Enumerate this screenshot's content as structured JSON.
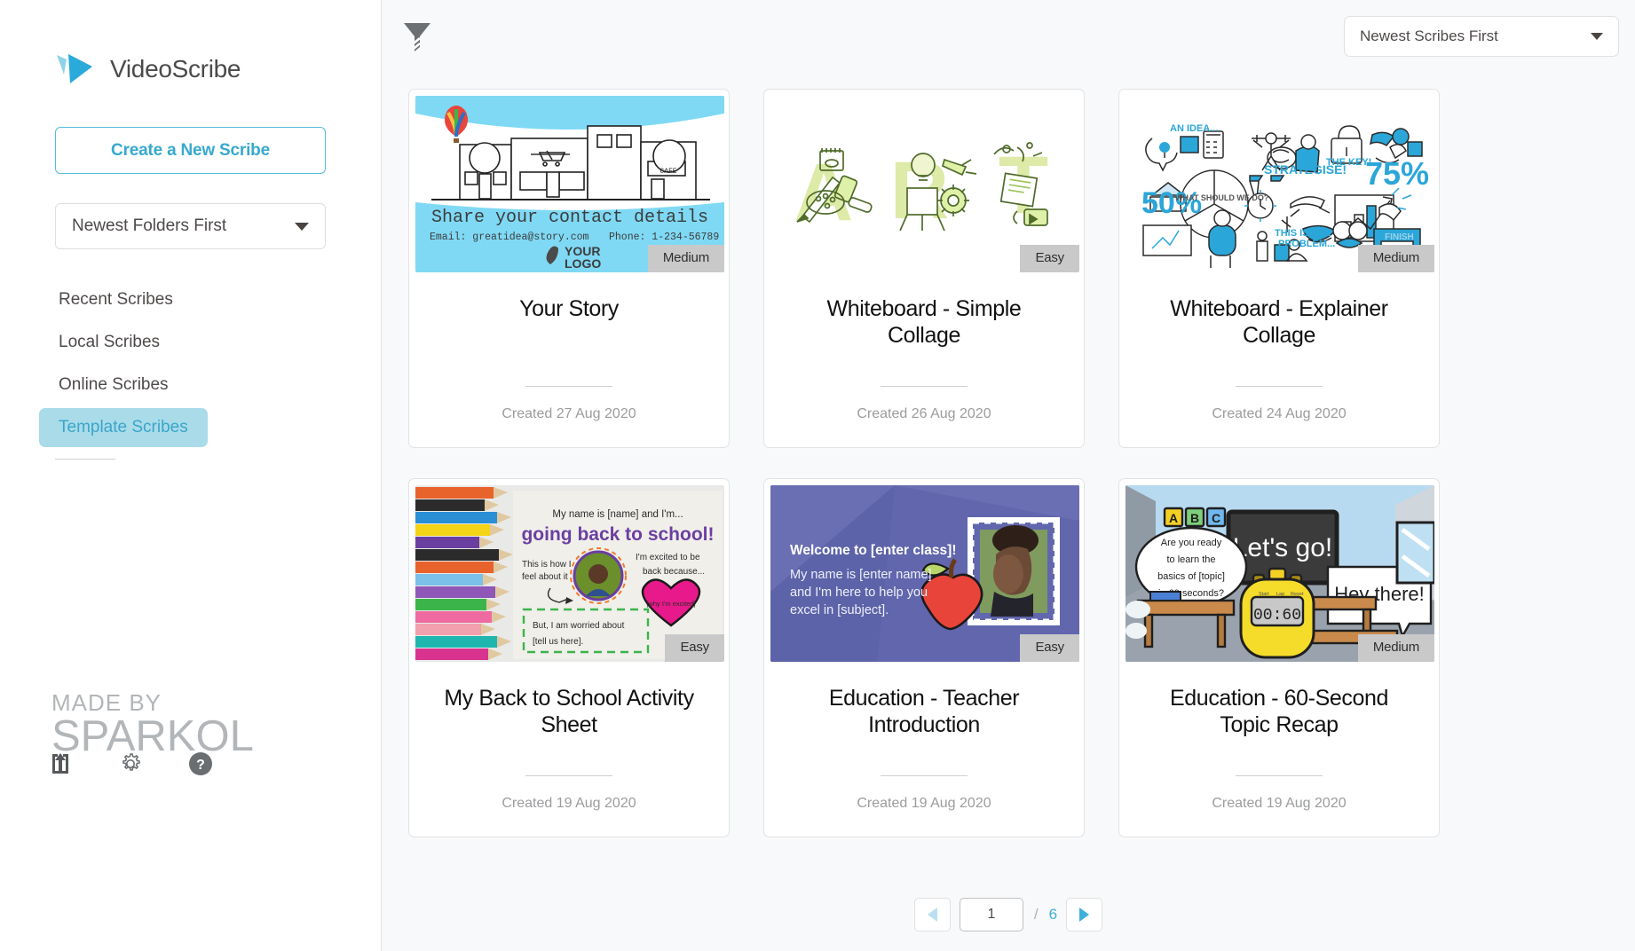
{
  "app": {
    "brand": "VideoScribe"
  },
  "sidebar": {
    "create_button": "Create a New Scribe",
    "folder_sort": {
      "value": "Newest Folders First"
    },
    "nav": [
      {
        "label": "Recent Scribes",
        "active": false
      },
      {
        "label": "Local Scribes",
        "active": false
      },
      {
        "label": "Online Scribes",
        "active": false
      },
      {
        "label": "Template Scribes",
        "active": true
      }
    ],
    "made_by": {
      "line1": "MADE BY",
      "line2": "SPARKOL"
    },
    "footer_icons": [
      {
        "name": "import-icon",
        "title": "Import"
      },
      {
        "name": "gear-icon",
        "title": "Settings"
      },
      {
        "name": "help-icon",
        "title": "Help"
      }
    ]
  },
  "toolbar": {
    "filter_icon": "filter-icon",
    "sort": {
      "value": "Newest Scribes First"
    }
  },
  "cards": [
    {
      "title": "Your Story",
      "date": "Created 27 Aug 2020",
      "badge": "Medium",
      "art": "your-story",
      "art_text": {
        "headline": "Share your contact details",
        "email": "Email: greatidea@story.com",
        "phone": "Phone: 1-234-56789",
        "logo1": "YOUR",
        "logo2": "LOGO",
        "cafe": "CAFE"
      }
    },
    {
      "title": "Whiteboard - Simple Collage",
      "date": "Created 26 Aug 2020",
      "badge": "Easy",
      "art": "art-letters",
      "art_text": {
        "letters": [
          "A",
          "R",
          "T"
        ]
      }
    },
    {
      "title": "Whiteboard - Explainer Collage",
      "date": "Created 24 Aug 2020",
      "badge": "Medium",
      "art": "explainer",
      "art_text": {
        "an_idea": "AN IDEA...",
        "fifty": "50%",
        "what_should": "WHAT SHOULD WE DO?",
        "strategise": "STRATEGISE!",
        "the_key": "THE KEY!",
        "seventyfive": "75%",
        "this_is": "THIS IS THE",
        "problem": "PROBLEM...",
        "finish": "FINISH"
      }
    },
    {
      "title": "My Back to School Activity Sheet",
      "date": "Created 19 Aug 2020",
      "badge": "Easy",
      "art": "back-to-school",
      "art_text": {
        "line1": "My name is [name] and I'm...",
        "big": "going back to school!",
        "feel1": "This is how I",
        "feel2": "feel about it",
        "excited1": "I'm excited to be",
        "excited2": "back because...",
        "heart": "[why I'm excited]",
        "worried1": "But, I am worried about",
        "worried2": "[tell us here]."
      }
    },
    {
      "title": "Education - Teacher Introduction",
      "date": "Created 19 Aug 2020",
      "badge": "Easy",
      "art": "teacher-intro",
      "art_text": {
        "welcome": "Welcome to [enter class]!",
        "body1": "My name is [enter name]",
        "body2": "and I'm here to help you",
        "body3": "excel in [subject]."
      }
    },
    {
      "title": "Education - 60-Second Topic Recap",
      "date": "Created 19 Aug 2020",
      "badge": "Medium",
      "art": "topic-recap",
      "art_text": {
        "blocks": [
          "A",
          "B",
          "C"
        ],
        "board": "Let's go!",
        "bubble1": "Are you ready",
        "bubble2": "to learn the",
        "bubble3": "basics of [topic]",
        "bubble4": "in 60 seconds?",
        "bubble_right": "Hey there!",
        "timer": "00:60",
        "timer_labels": [
          "Start",
          "Lap",
          "Reset"
        ]
      }
    }
  ],
  "pagination": {
    "prev": "prev-page",
    "current": "1",
    "separator": "/",
    "total": "6",
    "next": "next-page"
  },
  "colors": {
    "accent": "#3eaedd",
    "active_pill": "#a9dbe9",
    "badge_bg": "#c9c9c9",
    "main_bg": "#f8f9fa"
  }
}
